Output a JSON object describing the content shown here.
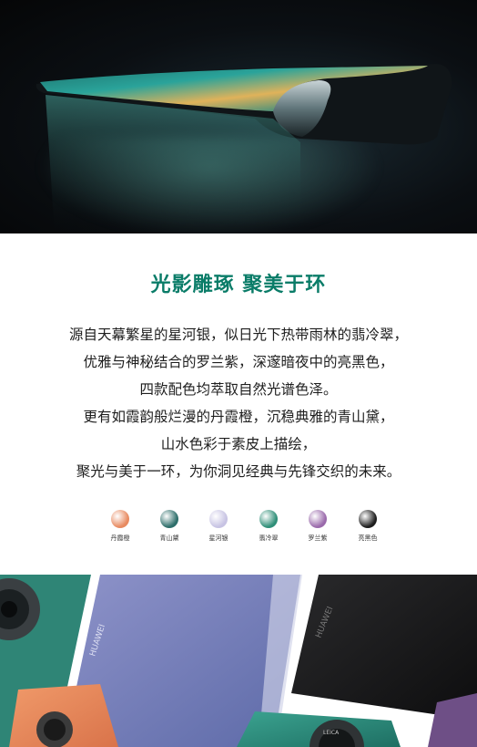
{
  "hero": {
    "description": ""
  },
  "intro": {
    "headline": "光影雕琢 聚美于环",
    "lines": [
      "源自天幕繁星的星河银，似日光下热带雨林的翡冷翠，",
      "优雅与神秘结合的罗兰紫，深邃暗夜中的亮黑色，",
      "四款配色均萃取自然光谱色泽。",
      "更有如霞韵般烂漫的丹霞橙，沉稳典雅的青山黛，",
      "山水色彩于素皮上描绘，",
      "聚光与美于一环，为你洞见经典与先锋交织的未来。"
    ]
  },
  "colors": [
    {
      "name": "丹霞橙",
      "color": "#e88a60"
    },
    {
      "name": "青山黛",
      "color": "#2d6e6a"
    },
    {
      "name": "星河银",
      "color": "#c7c3e3"
    },
    {
      "name": "翡冷翠",
      "color": "#2f8f78"
    },
    {
      "name": "罗兰紫",
      "color": "#9a6aab"
    },
    {
      "name": "亮黑色",
      "color": "#1d1d1d"
    }
  ],
  "gallery": {
    "brand_text": "HUAWEI",
    "lens_text": "LEICA"
  }
}
